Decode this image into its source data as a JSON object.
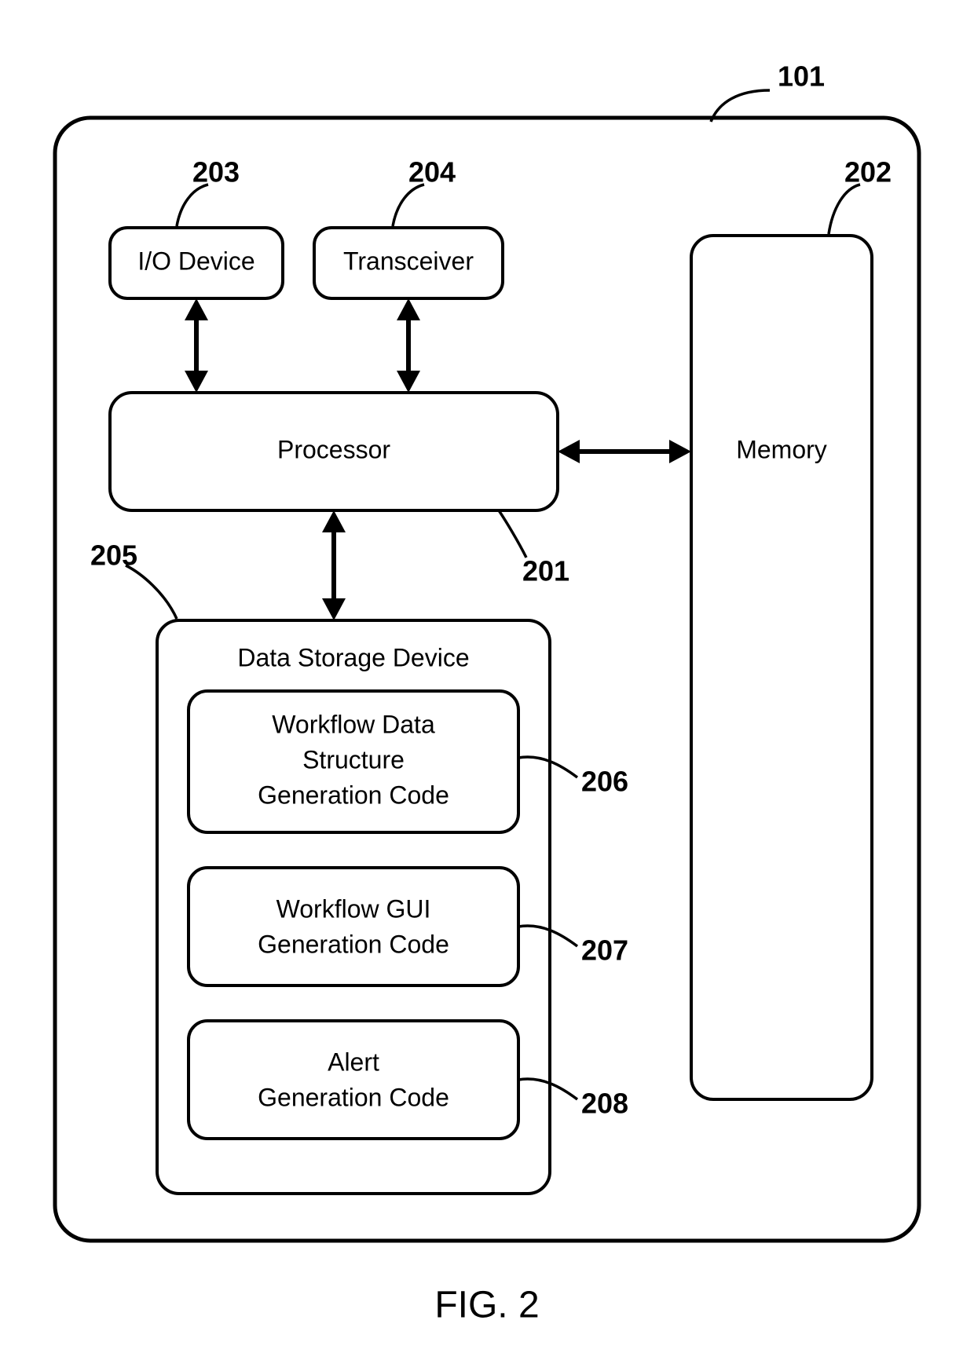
{
  "figure_label": "FIG. 2",
  "outer_ref": "101",
  "blocks": {
    "io": {
      "label": "I/O Device",
      "ref": "203"
    },
    "transceiver": {
      "label": "Transceiver",
      "ref": "204"
    },
    "processor": {
      "label": "Processor",
      "ref": "201"
    },
    "memory": {
      "label": "Memory",
      "ref": "202"
    },
    "storage": {
      "label": "Data Storage Device",
      "ref": "205"
    },
    "code1": {
      "line1": "Workflow Data",
      "line2": "Structure",
      "line3": "Generation Code",
      "ref": "206"
    },
    "code2": {
      "line1": "Workflow GUI",
      "line2": "Generation Code",
      "ref": "207"
    },
    "code3": {
      "line1": "Alert",
      "line2": "Generation Code",
      "ref": "208"
    }
  }
}
